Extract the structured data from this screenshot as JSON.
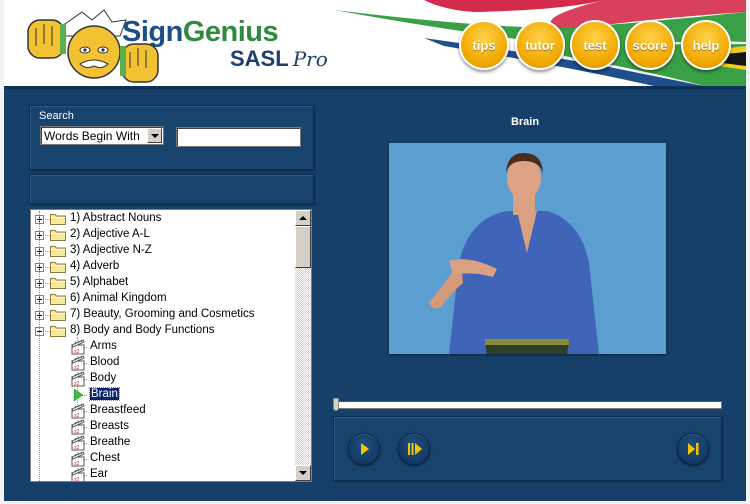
{
  "app": {
    "title_part1": "Sign",
    "title_part2": "Genius",
    "subtitle": "SASL",
    "subtitle_suffix": "Pro"
  },
  "colors": {
    "brand_blue": "#1d4e86",
    "brand_green": "#2f8a3f",
    "panel_bg": "#16406a",
    "nav_button": "#f0a800",
    "control_accent": "#f5c400",
    "selection": "#0a246a"
  },
  "nav": [
    {
      "label": "tips",
      "icon": "tips-button"
    },
    {
      "label": "tutor",
      "icon": "tutor-button"
    },
    {
      "label": "test",
      "icon": "test-button"
    },
    {
      "label": "score",
      "icon": "score-button"
    },
    {
      "label": "help",
      "icon": "help-button"
    }
  ],
  "search": {
    "label": "Search",
    "mode_selected": "Words Begin With",
    "query_value": "",
    "query_placeholder": ""
  },
  "tree": {
    "categories": [
      {
        "label": "1) Abstract Nouns",
        "expanded": false
      },
      {
        "label": "2) Adjective A-L",
        "expanded": false
      },
      {
        "label": "3) Adjective N-Z",
        "expanded": false
      },
      {
        "label": "4) Adverb",
        "expanded": false
      },
      {
        "label": "5) Alphabet",
        "expanded": false
      },
      {
        "label": "6) Animal Kingdom",
        "expanded": false
      },
      {
        "label": "7) Beauty, Grooming and Cosmetics",
        "expanded": false
      },
      {
        "label": "8) Body and Body Functions",
        "expanded": true
      }
    ],
    "words": [
      {
        "label": "Arms",
        "icon": "video-clip-icon",
        "selected": false
      },
      {
        "label": "Blood",
        "icon": "video-clip-icon",
        "selected": false
      },
      {
        "label": "Body",
        "icon": "video-clip-icon",
        "selected": false
      },
      {
        "label": "Brain",
        "icon": "play-arrow-icon",
        "selected": true
      },
      {
        "label": "Breastfeed",
        "icon": "video-clip-icon",
        "selected": false
      },
      {
        "label": "Breasts",
        "icon": "video-clip-icon",
        "selected": false
      },
      {
        "label": "Breathe",
        "icon": "video-clip-icon",
        "selected": false
      },
      {
        "label": "Chest",
        "icon": "video-clip-icon",
        "selected": false
      },
      {
        "label": "Ear",
        "icon": "video-clip-icon",
        "selected": false
      }
    ]
  },
  "video": {
    "title": "Brain",
    "progress": 0
  },
  "controls": [
    {
      "name": "play",
      "icon": "play-icon"
    },
    {
      "name": "slow-motion",
      "icon": "slow-play-icon"
    },
    {
      "name": "next",
      "icon": "skip-next-icon"
    }
  ]
}
